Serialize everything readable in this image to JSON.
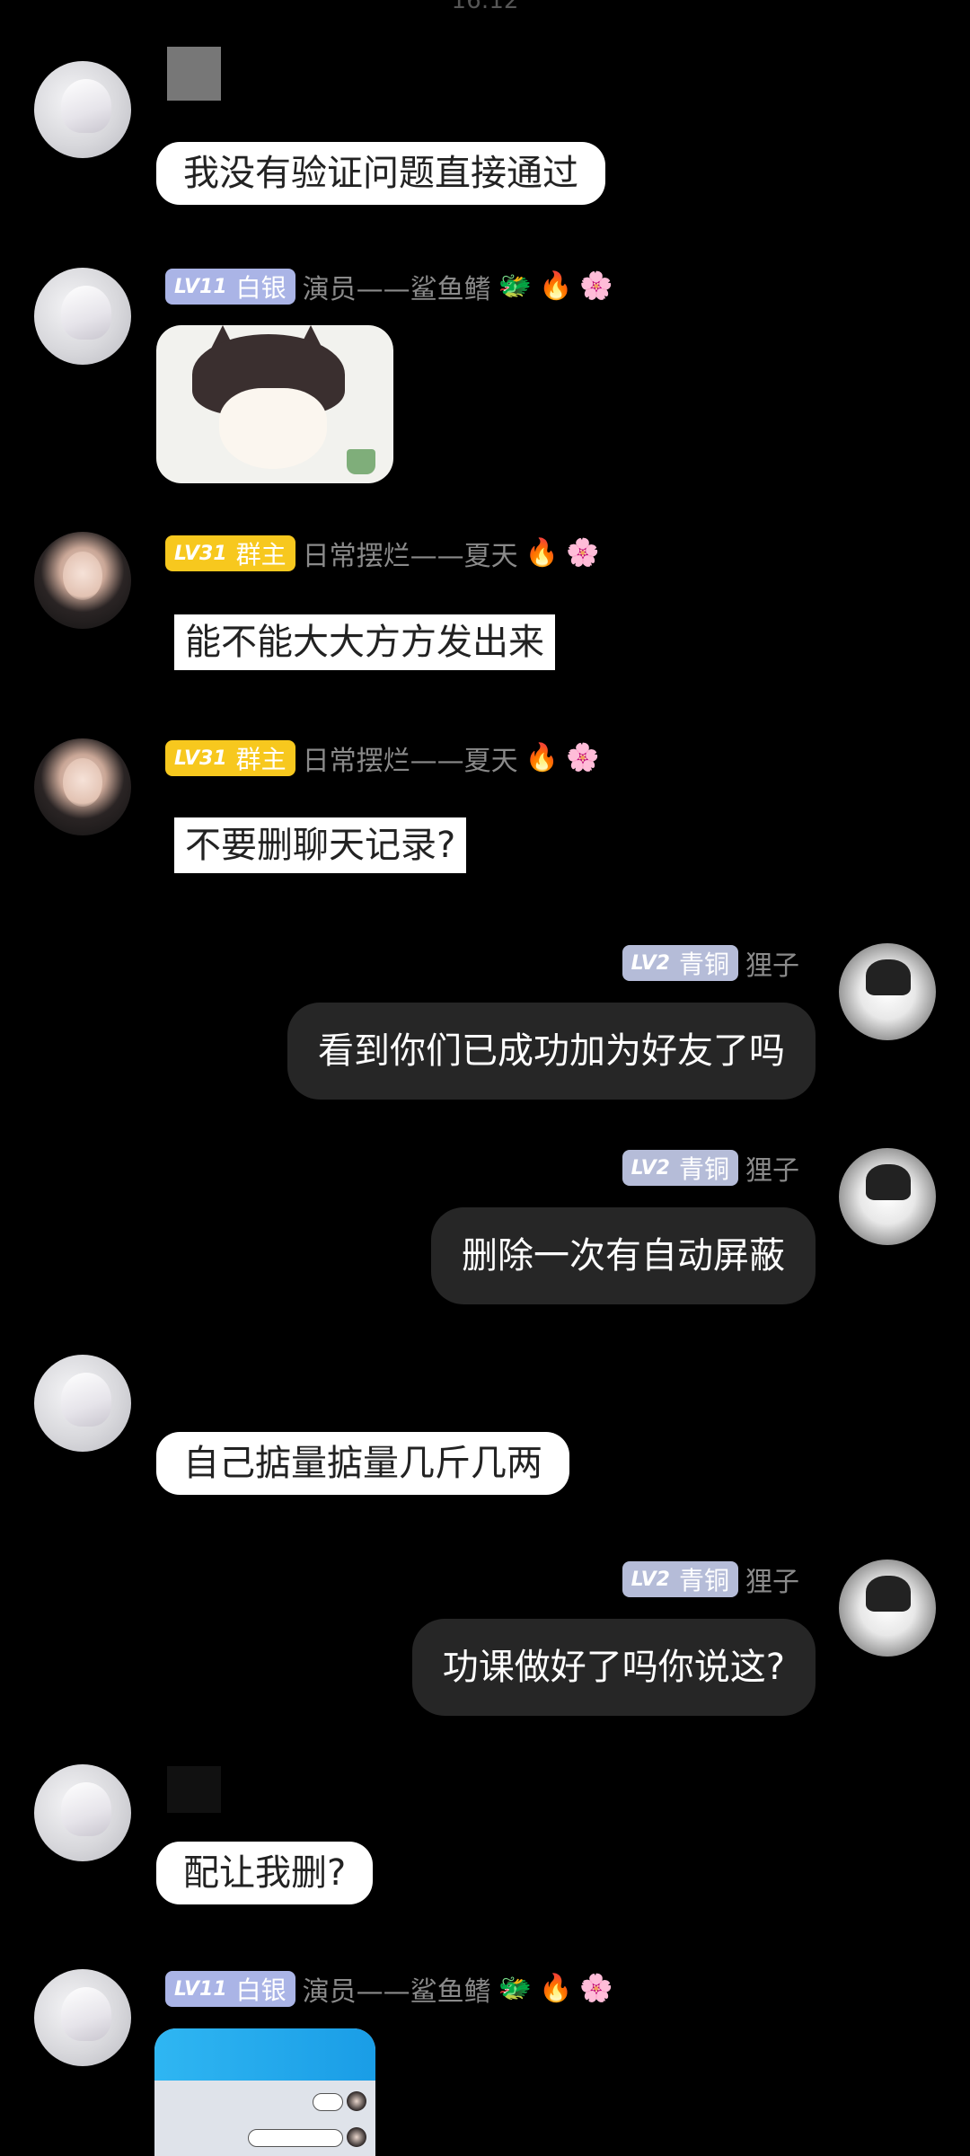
{
  "status_bar": {
    "time": "16:12"
  },
  "badges": {
    "silver": {
      "lv": "LV11",
      "title": "白银"
    },
    "gold": {
      "lv": "LV31",
      "title": "群主"
    },
    "bronze": {
      "lv": "LV2",
      "title": "青铜"
    }
  },
  "senders": {
    "actor": "演员——鲨鱼鳍",
    "owner": "日常摆烂——夏天",
    "me": "狸子"
  },
  "messages": [
    {
      "id": "m1",
      "side": "left",
      "text": "我没有验证问题直接通过"
    },
    {
      "id": "m2",
      "side": "left",
      "type": "sticker"
    },
    {
      "id": "m3",
      "side": "left",
      "text": "能不能大大方方发出来"
    },
    {
      "id": "m4",
      "side": "left",
      "text": "不要删聊天记录?"
    },
    {
      "id": "m5",
      "side": "right",
      "text": "看到你们已成功加为好友了吗"
    },
    {
      "id": "m6",
      "side": "right",
      "text": "删除一次有自动屏蔽"
    },
    {
      "id": "m7",
      "side": "left",
      "text": "自己掂量掂量几斤几两"
    },
    {
      "id": "m8",
      "side": "right",
      "text": "功课做好了吗你说这?"
    },
    {
      "id": "m9",
      "side": "left",
      "text": "配让我删?"
    },
    {
      "id": "m10",
      "side": "left",
      "type": "screenshot"
    }
  ],
  "icons": {
    "dragon": "🐲",
    "fire": "🔥",
    "flower": "🌸"
  }
}
